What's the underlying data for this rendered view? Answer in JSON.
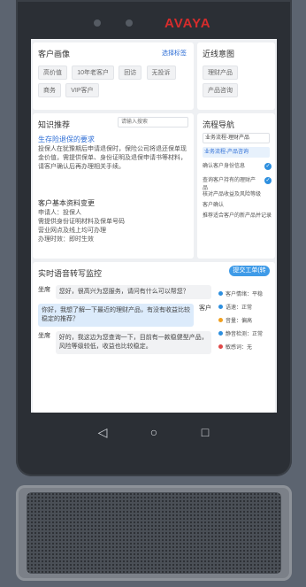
{
  "device": {
    "brand": "AVAYA"
  },
  "customer_profile": {
    "title": "客户画像",
    "action": "选择标签",
    "tags": [
      "高价值",
      "10年老客户",
      "回访",
      "无投诉",
      "商务",
      "VIP客户"
    ]
  },
  "recent_intent": {
    "title": "近线意图",
    "tags": [
      "理财产品",
      "产品咨询"
    ]
  },
  "knowledge": {
    "title": "知识推荐",
    "search_placeholder": "请输入搜索",
    "article_title": "生存险退保的要求",
    "article_body": "投保人在犹豫期后申请退保时，保险公司将退还保单现金价值，需提供保单、身份证明及退保申请书等材料，请客户确认后再办理相关手续。",
    "section_title": "客户基本资料变更",
    "section_lines": [
      "申请人：投保人",
      "需提供身份证明材料及保单号码",
      "营业网点及线上均可办理",
      "办理时效：即时生效"
    ]
  },
  "flow": {
    "title": "流程导航",
    "select": "业务流程-理财产品",
    "subselect": "业务流程-产品咨询",
    "steps": [
      {
        "text": "确认客户身份信息",
        "done": true
      },
      {
        "text": "查询客户持有的理财产品",
        "done": true
      },
      {
        "text": "核对产品收益及风险等级",
        "done": false
      },
      {
        "text": "客户确认",
        "done": false
      },
      {
        "text": "推荐适合客户的新产品并记录",
        "done": false
      }
    ]
  },
  "realtime": {
    "title": "实时语音转写监控",
    "button": "提交工单(转派)",
    "messages": [
      {
        "who": "坐席",
        "text": "您好，很高兴为您服务，请问有什么可以帮您？",
        "side": "left"
      },
      {
        "who": "客户",
        "text": "你好，我想了解一下最近的理财产品，有没有收益比较稳定的推荐？",
        "side": "right"
      },
      {
        "who": "坐席",
        "text": "好的，我这边为您查询一下，目前有一款稳健型产品，风险等级较低，收益也比较稳定。",
        "side": "left"
      }
    ],
    "status_items": [
      {
        "label": "客户情绪：平稳",
        "color": "#2d8fdf"
      },
      {
        "label": "语速：正常",
        "color": "#2d8fdf"
      },
      {
        "label": "音量：偏高",
        "color": "#f0a020"
      },
      {
        "label": "静音检测：正常",
        "color": "#2d8fdf"
      },
      {
        "label": "敏感词：无",
        "color": "#e04848"
      }
    ]
  },
  "navbar": {
    "back": "◁",
    "home": "○",
    "recent": "□"
  }
}
